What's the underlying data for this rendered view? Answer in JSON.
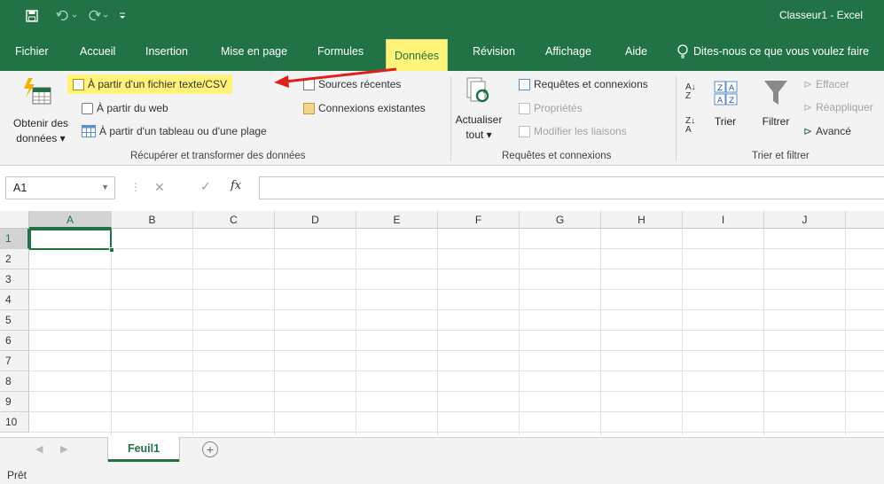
{
  "colors": {
    "accent": "#217346",
    "highlight": "#fff37a",
    "arrow": "#e0201c"
  },
  "titlebar": {
    "title": "Classeur1 - Excel",
    "icons": [
      "save-icon",
      "undo-icon",
      "redo-icon",
      "customize-qat-icon"
    ]
  },
  "tabs": [
    "Fichier",
    "Accueil",
    "Insertion",
    "Mise en page",
    "Formules",
    "Données",
    "Révision",
    "Affichage",
    "Aide"
  ],
  "active_tab": "Données",
  "tell_me": "Dites-nous ce que vous voulez faire",
  "ribbon": {
    "get_data": {
      "line1": "Obtenir des",
      "line2": "données ▾"
    },
    "from_text_csv": "À partir d'un fichier texte/CSV",
    "from_web": "À partir du web",
    "from_table": "À partir d'un tableau ou d'une plage",
    "recent_sources": "Sources récentes",
    "existing_connections": "Connexions existantes",
    "group_get_transform": "Récupérer et transformer des données",
    "refresh_all": {
      "line1": "Actualiser",
      "line2": "tout ▾"
    },
    "queries_connections": "Requêtes et connexions",
    "properties": "Propriétés",
    "edit_links": "Modifier les liaisons",
    "group_queries": "Requêtes et connexions",
    "sort": "Trier",
    "filter": "Filtrer",
    "clear": "Effacer",
    "reapply": "Réappliquer",
    "advanced": "Avancé",
    "group_sort_filter": "Trier et filtrer"
  },
  "formula_bar": {
    "name_box": "A1",
    "fx_label": "fx",
    "value": ""
  },
  "columns": [
    "A",
    "B",
    "C",
    "D",
    "E",
    "F",
    "G",
    "H",
    "I",
    "J"
  ],
  "rows": [
    "1",
    "2",
    "3",
    "4",
    "5",
    "6",
    "7",
    "8",
    "9",
    "10"
  ],
  "active_cell": "A1",
  "sheets": [
    "Feuil1"
  ],
  "status": "Prêt"
}
